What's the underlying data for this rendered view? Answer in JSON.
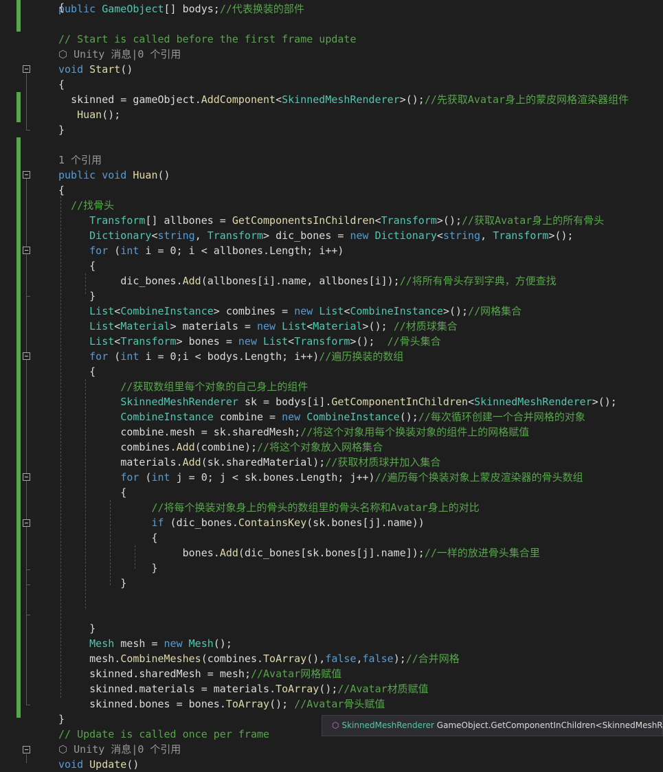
{
  "lines": [
    "public GameObject[] bodys;//代表换装的部件",
    "",
    "// Start is called before the first frame update",
    "⬛ Unity 消息|0 个引用",
    "void Start()",
    "{",
    "  skinned = gameObject.AddComponent<SkinnedMeshRenderer>();//先获取Avatar身上的蒙皮网格渲染器组件",
    "   Huan();",
    "}",
    "",
    "1 个引用",
    "public void Huan()",
    "{",
    "  //找骨头",
    "     Transform[] allbones = GetComponentsInChildren<Transform>();//获取Avatar身上的所有骨头",
    "     Dictionary<string, Transform> dic_bones = new Dictionary<string, Transform>();",
    "     for (int i = 0; i < allbones.Length; i++)",
    "     {",
    "          dic_bones.Add(allbones[i].name, allbones[i]);//将所有骨头存到字典，方便查找",
    "     }",
    "     List<CombineInstance> combines = new List<CombineInstance>();//网格集合",
    "     List<Material> materials = new List<Material>(); //材质球集合",
    "     List<Transform> bones = new List<Transform>();  //骨头集合",
    "     for (int i = 0;i < bodys.Length; i++)//遍历换装的数组",
    "     {",
    "          //获取数组里每个对象的自己身上的组件",
    "          SkinnedMeshRenderer sk = bodys[i].GetComponentInChildren<SkinnedMeshRenderer>();",
    "          CombineInstance combine = new CombineInstance();//每次循环创建一个合并网格的对象",
    "          combine.mesh = sk.sharedMesh;//将这个对象用每个换装对象的组件上的网格赋值",
    "          combines.Add(combine);//将这个对象放入网格集合",
    "          materials.Add(sk.sharedMaterial);//获取材质球并加入集合",
    "          for (int j = 0; j < sk.bones.Length; j++)//遍历每个换装对象上蒙皮渲染器的骨头数组",
    "          {",
    "               //将每个换装对象身上的骨头的数组里的骨头名称和Avatar身上的对比",
    "               if (dic_bones.ContainsKey(sk.bones[j].name))",
    "               {",
    "                    bones.Add(dic_bones[sk.bones[j].name]);//一样的放进骨头集合里",
    "               }",
    "          }",
    "",
    "",
    "     }",
    "     Mesh mesh = new Mesh();",
    "     mesh.CombineMeshes(combines.ToArray(),false,false);//合并网格",
    "     skinned.sharedMesh = mesh;//Avatar网格赋值",
    "     skinned.materials = materials.ToArray();//Avatar材质赋值",
    "     skinned.bones = bones.ToArray(); //Avatar骨头赋值",
    "}",
    "// Update is called once per frame",
    "⬛ Unity 消息|0 个引用",
    "void Update()",
    "{"
  ],
  "tooltip": {
    "type": "SkinnedMeshRenderer",
    "member": "GameObject.GetComponentInChildren<SkinnedMeshRer"
  },
  "colors": {
    "background": "#1e1e1e",
    "keyword": "#569cd6",
    "type": "#4ec9b0",
    "comment": "#57a64a",
    "codelens": "#999999",
    "method": "#dcdcaa",
    "change_bar": "#57a64a"
  },
  "icons": [
    "unity-cube-icon",
    "collapse-icon",
    "method-icon"
  ]
}
